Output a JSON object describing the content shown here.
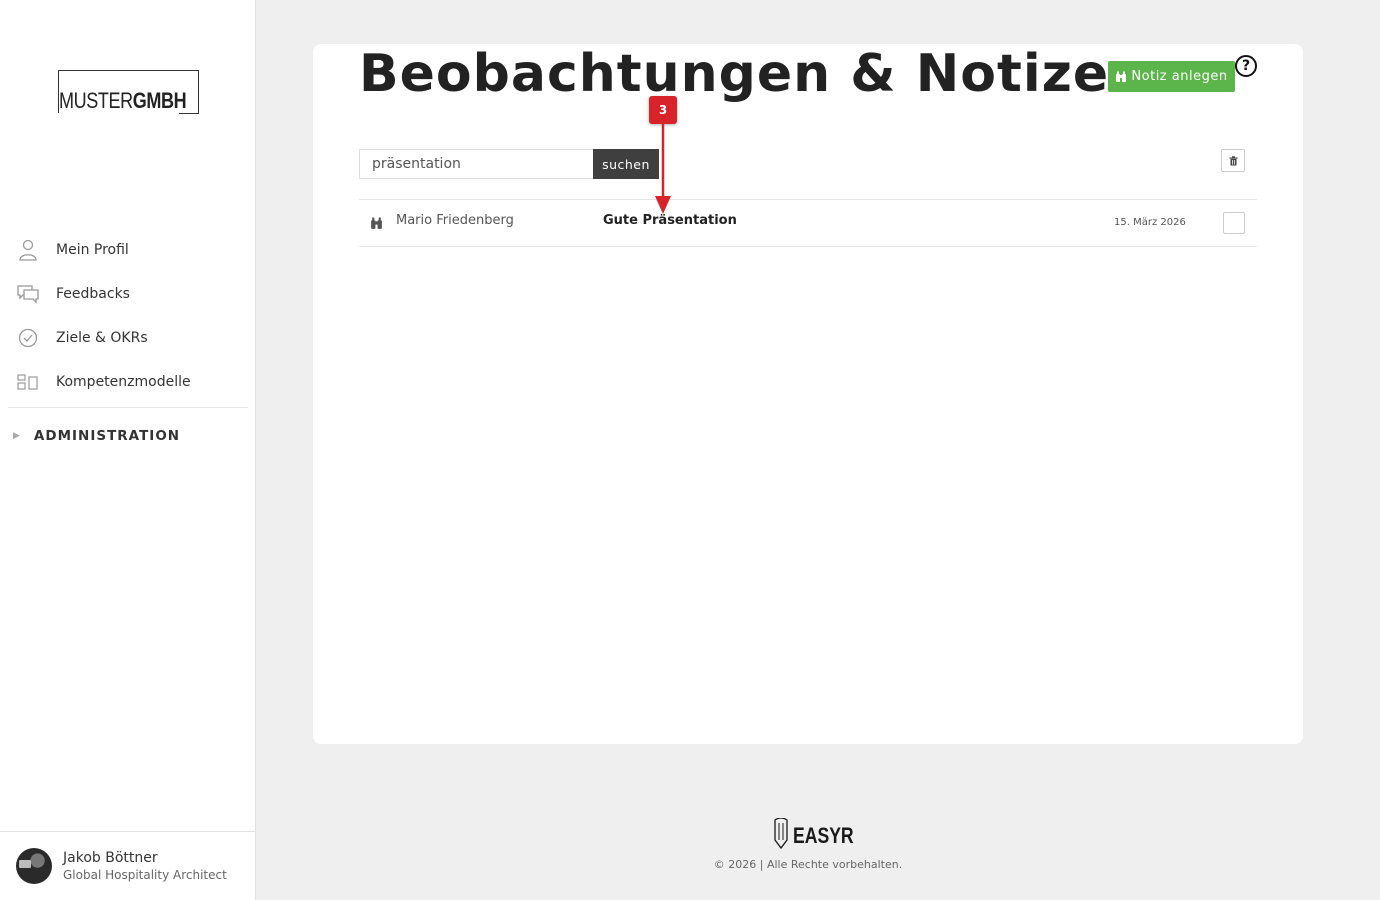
{
  "sidebar": {
    "logo": {
      "light": "MUSTER",
      "bold": "GMBH"
    },
    "items": [
      {
        "label": "Mein Profil",
        "icon": "user-icon"
      },
      {
        "label": "Feedbacks",
        "icon": "chat-bubbles-icon"
      },
      {
        "label": "Ziele & OKRs",
        "icon": "check-circle-icon"
      },
      {
        "label": "Kompetenzmodelle",
        "icon": "models-icon"
      }
    ],
    "admin_label": "ADMINISTRATION",
    "profile": {
      "name": "Jakob Böttner",
      "role": "Global Hospitality Architect"
    }
  },
  "main": {
    "title": "Beobachtungen & Notizen",
    "new_button_label": "Notiz anlegen",
    "help_label": "?",
    "search": {
      "value": "präsentation",
      "button_label": "suchen"
    },
    "notes": [
      {
        "author": "Mario Friedenberg",
        "title": "Gute Präsentation",
        "date": "15. März 2026"
      }
    ]
  },
  "annotation": {
    "step": "3",
    "color": "#d9232a"
  },
  "footer": {
    "brand": "EASYR",
    "copyright": "© 2026 | Alle Rechte vorbehalten."
  },
  "colors": {
    "accent_green": "#5cb54a",
    "dark_button": "#3f3f3f"
  }
}
